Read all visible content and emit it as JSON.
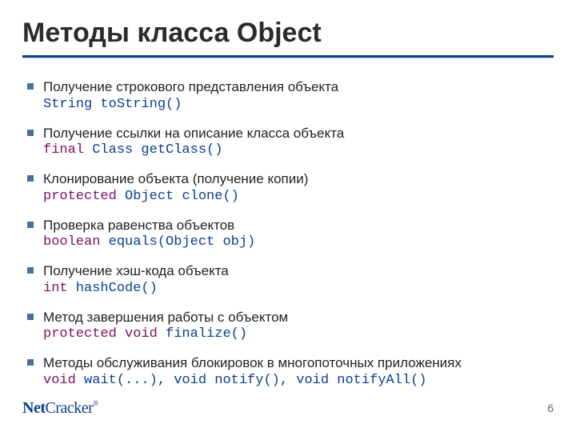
{
  "title": "Методы класса Object",
  "items": [
    {
      "desc": "Получение строкового представления объекта",
      "sig_pre": "",
      "sig_kw": "",
      "sig_post": "String toString()"
    },
    {
      "desc": "Получение ссылки на описание класса объекта",
      "sig_pre": "",
      "sig_kw": "final",
      "sig_post": " Class getClass()"
    },
    {
      "desc": "Клонирование объекта (получение копии)",
      "sig_pre": "",
      "sig_kw": "protected",
      "sig_post": " Object clone()"
    },
    {
      "desc": "Проверка равенства объектов",
      "sig_pre": "",
      "sig_kw": "boolean",
      "sig_post": " equals(Object obj)"
    },
    {
      "desc": "Получение хэш-кода объекта",
      "sig_pre": "",
      "sig_kw": "int",
      "sig_post": " hashCode()"
    },
    {
      "desc": "Метод завершения работы с объектом",
      "sig_pre": "",
      "sig_kw": "protected void",
      "sig_post": " finalize()"
    },
    {
      "desc": "Методы обслуживания блокировок в многопоточных приложениях",
      "sig_pre": "",
      "sig_kw": "void",
      "sig_post": " wait(...), void notify(), void notifyAll()"
    }
  ],
  "logo": {
    "net": "Net",
    "cracker": "Cracker",
    "r": "®"
  },
  "page": "6"
}
